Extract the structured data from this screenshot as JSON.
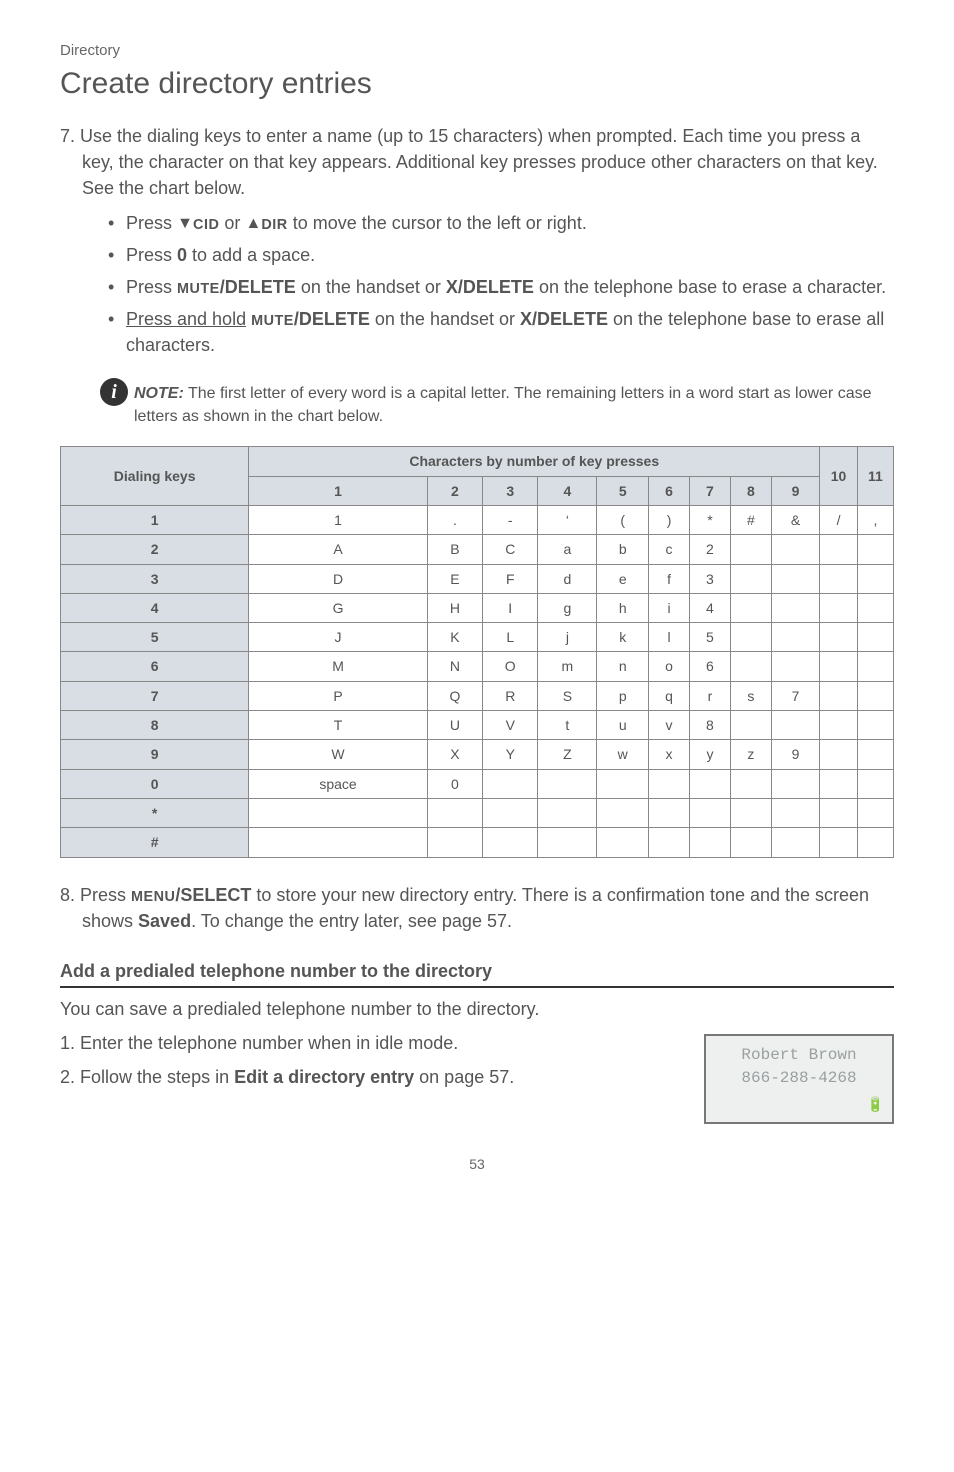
{
  "breadcrumb": "Directory",
  "title": "Create directory entries",
  "step7": {
    "lead": "7. Use the dialing keys to enter a name (up to 15 characters) when prompted. Each time you press a key, the character on that key appears. Additional key presses produce other characters on that key. See the chart below.",
    "b1_pre": "Press ",
    "b1_down_arrow": "▼",
    "b1_cid": "CID",
    "b1_or": " or ",
    "b1_up_arrow": "▲",
    "b1_dir": "DIR",
    "b1_post": " to move the cursor to the left or right.",
    "b2_pre": "Press ",
    "b2_key": "0",
    "b2_post": " to add a space.",
    "b3_pre": "Press ",
    "b3_mute": "MUTE",
    "b3_del": "/DELETE",
    "b3_mid": " on the handset or ",
    "b3_x": "X/DELETE",
    "b3_post": " on the telephone base to erase a character.",
    "b4_pre": "Press and hold",
    "b4_space": " ",
    "b4_mute": "MUTE",
    "b4_del": "/DELETE",
    "b4_mid": " on the handset or ",
    "b4_x": "X/DELETE",
    "b4_post": " on the telephone base to erase all characters."
  },
  "note": {
    "label": "NOTE:",
    "text": " The first letter of every word is a capital letter. The remaining letters in a word start as lower case letters as shown in the chart below."
  },
  "table": {
    "header_dialing": "Dialing keys",
    "header_chars": "Characters by number of key presses",
    "cols": [
      "1",
      "2",
      "3",
      "4",
      "5",
      "6",
      "7",
      "8",
      "9",
      "10",
      "11"
    ],
    "rows": {
      "1": [
        "1",
        ".",
        "-",
        "‘",
        "(",
        ")",
        "*",
        "#",
        "&",
        "/",
        ","
      ],
      "2": [
        "A",
        "B",
        "C",
        "a",
        "b",
        "c",
        "2",
        "",
        "",
        "",
        ""
      ],
      "3": [
        "D",
        "E",
        "F",
        "d",
        "e",
        "f",
        "3",
        "",
        "",
        "",
        ""
      ],
      "4": [
        "G",
        "H",
        "I",
        "g",
        "h",
        "i",
        "4",
        "",
        "",
        "",
        ""
      ],
      "5": [
        "J",
        "K",
        "L",
        "j",
        "k",
        "l",
        "5",
        "",
        "",
        "",
        ""
      ],
      "6": [
        "M",
        "N",
        "O",
        "m",
        "n",
        "o",
        "6",
        "",
        "",
        "",
        ""
      ],
      "7": [
        "P",
        "Q",
        "R",
        "S",
        "p",
        "q",
        "r",
        "s",
        "7",
        "",
        ""
      ],
      "8": [
        "T",
        "U",
        "V",
        "t",
        "u",
        "v",
        "8",
        "",
        "",
        "",
        ""
      ],
      "9": [
        "W",
        "X",
        "Y",
        "Z",
        "w",
        "x",
        "y",
        "z",
        "9",
        "",
        ""
      ],
      "0": [
        "space",
        "0",
        "",
        "",
        "",
        "",
        "",
        "",
        "",
        "",
        ""
      ],
      "*": [
        "",
        "",
        "",
        "",
        "",
        "",
        "",
        "",
        "",
        "",
        ""
      ],
      "#": [
        "",
        "",
        "",
        "",
        "",
        "",
        "",
        "",
        "",
        "",
        ""
      ]
    },
    "row_order": [
      "1",
      "2",
      "3",
      "4",
      "5",
      "6",
      "7",
      "8",
      "9",
      "0",
      "*",
      "#"
    ]
  },
  "step8": {
    "pre": "8. Press ",
    "menu": "MENU",
    "select": "/SELECT",
    "mid": " to store your new directory entry. There is a confirmation tone and the screen shows ",
    "saved": "Saved",
    "post": ". To change the entry later, see page 57."
  },
  "predial": {
    "heading": "Add a predialed telephone number to the directory",
    "lead": "You can save a predialed telephone number to the directory.",
    "s1": "1. Enter the telephone number when in idle mode.",
    "s2_pre": "2. Follow the steps in ",
    "s2_bold": "Edit a directory entry",
    "s2_post": " on page 57."
  },
  "screen": {
    "line1": "Robert Brown",
    "line2": "866-288-4268",
    "battery": "🔋"
  },
  "chart_data": {
    "type": "table",
    "title": "Characters by number of key presses",
    "row_label": "Dialing keys",
    "columns": [
      "1",
      "2",
      "3",
      "4",
      "5",
      "6",
      "7",
      "8",
      "9",
      "10",
      "11"
    ],
    "rows": [
      {
        "key": "1",
        "values": [
          "1",
          ".",
          "-",
          "‘",
          "(",
          ")",
          "*",
          "#",
          "&",
          "/",
          ","
        ]
      },
      {
        "key": "2",
        "values": [
          "A",
          "B",
          "C",
          "a",
          "b",
          "c",
          "2",
          "",
          "",
          "",
          ""
        ]
      },
      {
        "key": "3",
        "values": [
          "D",
          "E",
          "F",
          "d",
          "e",
          "f",
          "3",
          "",
          "",
          "",
          ""
        ]
      },
      {
        "key": "4",
        "values": [
          "G",
          "H",
          "I",
          "g",
          "h",
          "i",
          "4",
          "",
          "",
          "",
          ""
        ]
      },
      {
        "key": "5",
        "values": [
          "J",
          "K",
          "L",
          "j",
          "k",
          "l",
          "5",
          "",
          "",
          "",
          ""
        ]
      },
      {
        "key": "6",
        "values": [
          "M",
          "N",
          "O",
          "m",
          "n",
          "o",
          "6",
          "",
          "",
          "",
          ""
        ]
      },
      {
        "key": "7",
        "values": [
          "P",
          "Q",
          "R",
          "S",
          "p",
          "q",
          "r",
          "s",
          "7",
          "",
          ""
        ]
      },
      {
        "key": "8",
        "values": [
          "T",
          "U",
          "V",
          "t",
          "u",
          "v",
          "8",
          "",
          "",
          "",
          ""
        ]
      },
      {
        "key": "9",
        "values": [
          "W",
          "X",
          "Y",
          "Z",
          "w",
          "x",
          "y",
          "z",
          "9",
          "",
          ""
        ]
      },
      {
        "key": "0",
        "values": [
          "space",
          "0",
          "",
          "",
          "",
          "",
          "",
          "",
          "",
          "",
          ""
        ]
      },
      {
        "key": "*",
        "values": [
          "",
          "",
          "",
          "",
          "",
          "",
          "",
          "",
          "",
          "",
          ""
        ]
      },
      {
        "key": "#",
        "values": [
          "",
          "",
          "",
          "",
          "",
          "",
          "",
          "",
          "",
          "",
          ""
        ]
      }
    ]
  },
  "page_number": "53"
}
